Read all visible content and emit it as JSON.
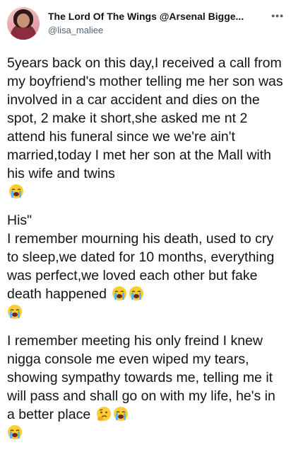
{
  "tweet": {
    "display_name": "The Lord Of The Wings @Arsenal Bigge...",
    "handle": "@lisa_maliee",
    "more_icon": "more-horizontal-icon",
    "paragraphs": {
      "p1": "5years back on this day,I received a call from my boyfriend's mother telling me her son was involved in a car accident and dies on the spot, 2 make it short,she asked me nt 2 attend his funeral since we we're ain't married,today I met her son at the Mall with his wife and twins",
      "p2_line1": "His\"",
      "p2_rest": "I remember mourning his death, used to cry to sleep,we dated for 10 months, everything was perfect,we loved each other but fake death happened",
      "p3": "I remember meeting his only freind I knew nigga console me even wiped my tears, showing sympathy towards me, telling me it will pass and shall go on with my life, he's in a better place"
    },
    "emojis": {
      "crying": "loudly-crying-face-icon",
      "thinking": "thinking-face-icon"
    }
  }
}
